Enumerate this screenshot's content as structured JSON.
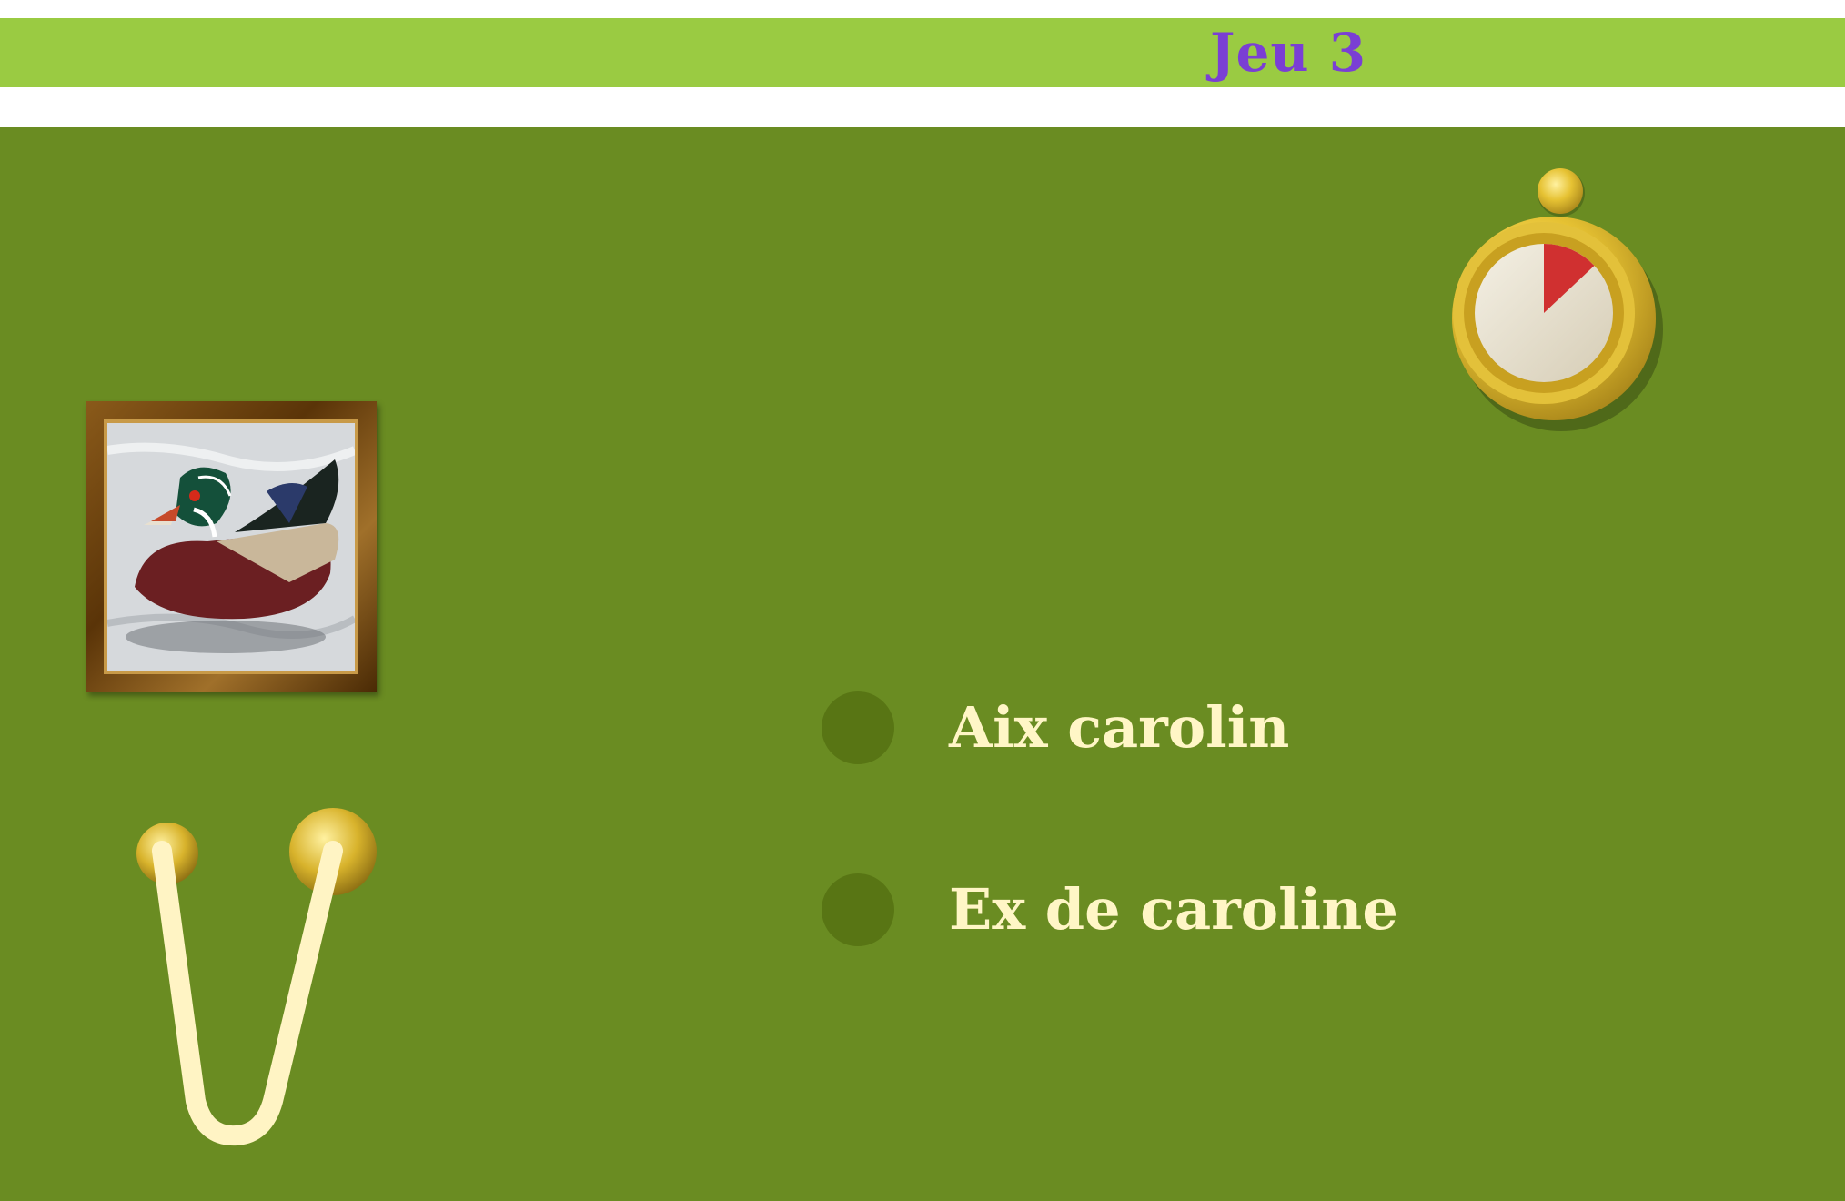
{
  "header": {
    "title": "Jeu 3"
  },
  "picture": {
    "subject": "wood duck photo",
    "frame_color": "#6b4210"
  },
  "options": [
    {
      "label": "Aix carolin"
    },
    {
      "label": "Ex de caroline"
    }
  ],
  "timer": {
    "icon": "stopwatch-icon",
    "elapsed_fraction": 0.13,
    "accent": "#d03030"
  },
  "swing": {
    "icon": "rope-swing-icon"
  },
  "colors": {
    "topbar": "#9acb42",
    "board": "#6a8c22",
    "title": "#7a3fd4",
    "option_text": "#fff6c6",
    "option_dot": "#587514",
    "gold": "#e6c233"
  }
}
